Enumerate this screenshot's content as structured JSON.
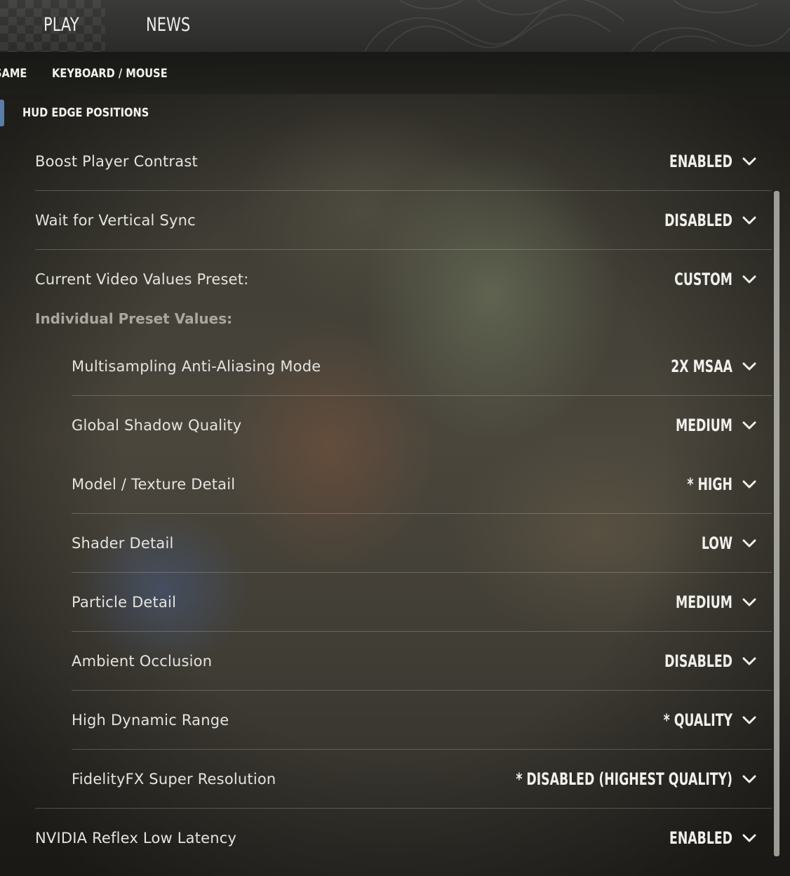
{
  "nav": {
    "tabs": [
      {
        "label": "PLAY"
      },
      {
        "label": "NEWS"
      }
    ]
  },
  "subnav": {
    "tabs": [
      {
        "label": "SAME"
      },
      {
        "label": "KEYBOARD / MOUSE"
      }
    ]
  },
  "section": {
    "label": "HUD EDGE POSITIONS"
  },
  "settings": {
    "boost_player_contrast": {
      "label": "Boost Player Contrast",
      "value": "ENABLED"
    },
    "wait_vsync": {
      "label": "Wait for Vertical Sync",
      "value": "DISABLED"
    },
    "video_preset": {
      "label": "Current Video Values Preset:",
      "value": "CUSTOM"
    },
    "individual_header": "Individual Preset Values:",
    "msaa": {
      "label": "Multisampling Anti-Aliasing Mode",
      "value": "2X MSAA"
    },
    "shadow": {
      "label": "Global Shadow Quality",
      "value": "MEDIUM"
    },
    "texture": {
      "label": "Model / Texture Detail",
      "value": "* HIGH"
    },
    "shader": {
      "label": "Shader Detail",
      "value": "LOW"
    },
    "particle": {
      "label": "Particle Detail",
      "value": "MEDIUM"
    },
    "ambient": {
      "label": "Ambient Occlusion",
      "value": "DISABLED"
    },
    "hdr": {
      "label": "High Dynamic Range",
      "value": "* QUALITY"
    },
    "fsr": {
      "label": "FidelityFX Super Resolution",
      "value": "* DISABLED (HIGHEST QUALITY)"
    },
    "reflex": {
      "label": "NVIDIA Reflex Low Latency",
      "value": "ENABLED"
    }
  },
  "colors": {
    "accent": "#5b7ea8",
    "text": "#e4e4df",
    "muted": "#a8a89f"
  },
  "icons": {
    "dropdown": "chevron-down-icon"
  }
}
